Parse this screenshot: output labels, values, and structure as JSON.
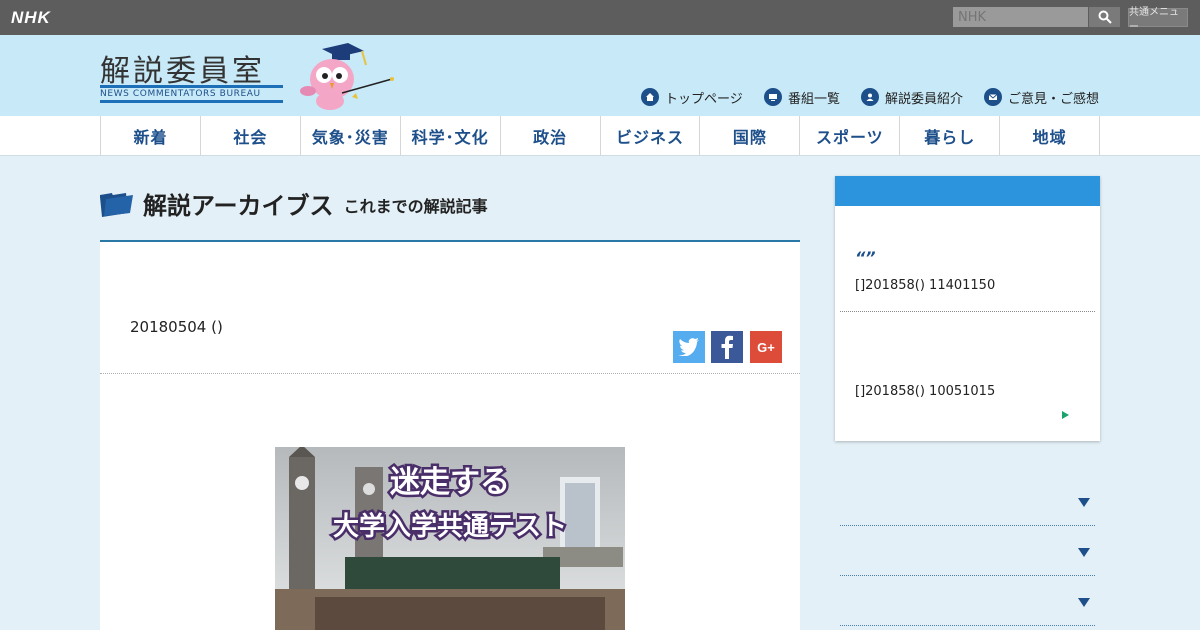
{
  "topbar": {
    "logo": "NHK",
    "search_placeholder": "NHK",
    "menu_label": "共通メニュー"
  },
  "header": {
    "title": "解説委員室",
    "subtitle": "NEWS COMMENTATORS BUREAU",
    "links": [
      {
        "label": "トップページ",
        "icon": "home-icon"
      },
      {
        "label": "番組一覧",
        "icon": "tv-icon"
      },
      {
        "label": "解説委員紹介",
        "icon": "person-icon"
      },
      {
        "label": "ご意見・ご感想",
        "icon": "mail-icon"
      }
    ]
  },
  "nav": {
    "items": [
      "新着",
      "社会",
      "気象･災害",
      "科学･文化",
      "政治",
      "ビジネス",
      "国際",
      "スポーツ",
      "暮らし",
      "地域"
    ]
  },
  "page": {
    "title": "解説アーカイブス",
    "subtitle": "これまでの解説記事"
  },
  "article": {
    "date": "20180504 ()",
    "share": [
      {
        "name": "twitter",
        "color": "#55acee"
      },
      {
        "name": "facebook",
        "color": "#3b5998"
      },
      {
        "name": "google-plus",
        "color": "#dd4b39",
        "label": "G+"
      }
    ],
    "hero": {
      "line1": "迷走する",
      "line2": "大学入学共通テスト"
    }
  },
  "sidebar": {
    "quote_mark": "“”",
    "item1": "[]201858() 11401150",
    "item2": "[]201858() 10051015"
  },
  "colors": {
    "topbar": "#5d5d5d",
    "header": "#c8e9f7",
    "nav_text": "#1d4f8a",
    "accent": "#2b94dc",
    "page_bg": "#e3f0f7"
  }
}
